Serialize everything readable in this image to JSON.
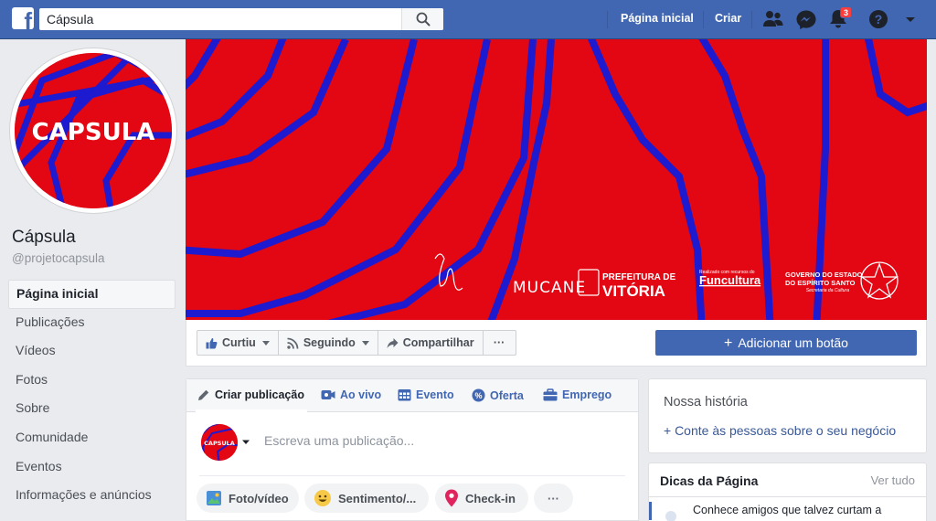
{
  "topbar": {
    "logo": "f",
    "search_value": "Cápsula",
    "search_icon": "search-icon",
    "home_label": "Página inicial",
    "create_label": "Criar",
    "notification_count": "3",
    "icons": [
      "friend-requests-icon",
      "messenger-icon",
      "notifications-icon",
      "help-icon",
      "account-menu-chevron-icon"
    ],
    "color": "#4267b2"
  },
  "profile": {
    "avatar_text": "CAPSULA",
    "name": "Cápsula",
    "handle": "@projetocapsula"
  },
  "sidebar": {
    "items": [
      {
        "label": "Página inicial",
        "active": true
      },
      {
        "label": "Publicações"
      },
      {
        "label": "Vídeos"
      },
      {
        "label": "Fotos"
      },
      {
        "label": "Sobre"
      },
      {
        "label": "Comunidade"
      },
      {
        "label": "Eventos"
      },
      {
        "label": "Informações e anúncios"
      }
    ]
  },
  "cover": {
    "background_color": "#e30613",
    "stripe_color": "#1d1ad0",
    "logos": {
      "mucane": "MUCANE",
      "prefeitura_line1": "PREFEITURA DE",
      "prefeitura_line2": "VITÓRIA",
      "funcultura_small": "Realizado com recursos do",
      "funcultura": "Funcultura",
      "governo_line1": "GOVERNO DO ESTADO",
      "governo_line2": "DO ESPÍRITO SANTO",
      "governo_line3": "Secretaria da Cultura"
    }
  },
  "actions": {
    "like": "Curtiu",
    "follow": "Seguindo",
    "share": "Compartilhar",
    "more": "···",
    "add_button": "Adicionar um botão",
    "add_plus": "+"
  },
  "composer": {
    "tabs": [
      "Criar publicação",
      "Ao vivo",
      "Evento",
      "Oferta",
      "Emprego"
    ],
    "placeholder": "Escreva uma publicação...",
    "pills": [
      "Foto/vídeo",
      "Sentimento/...",
      "Check-in",
      "···"
    ]
  },
  "story": {
    "title": "Nossa história",
    "link": "+ Conte às pessoas sobre o seu negócio"
  },
  "tips": {
    "title": "Dicas da Página",
    "link": "Ver tudo",
    "item": "Conhece amigos que talvez curtam a"
  }
}
